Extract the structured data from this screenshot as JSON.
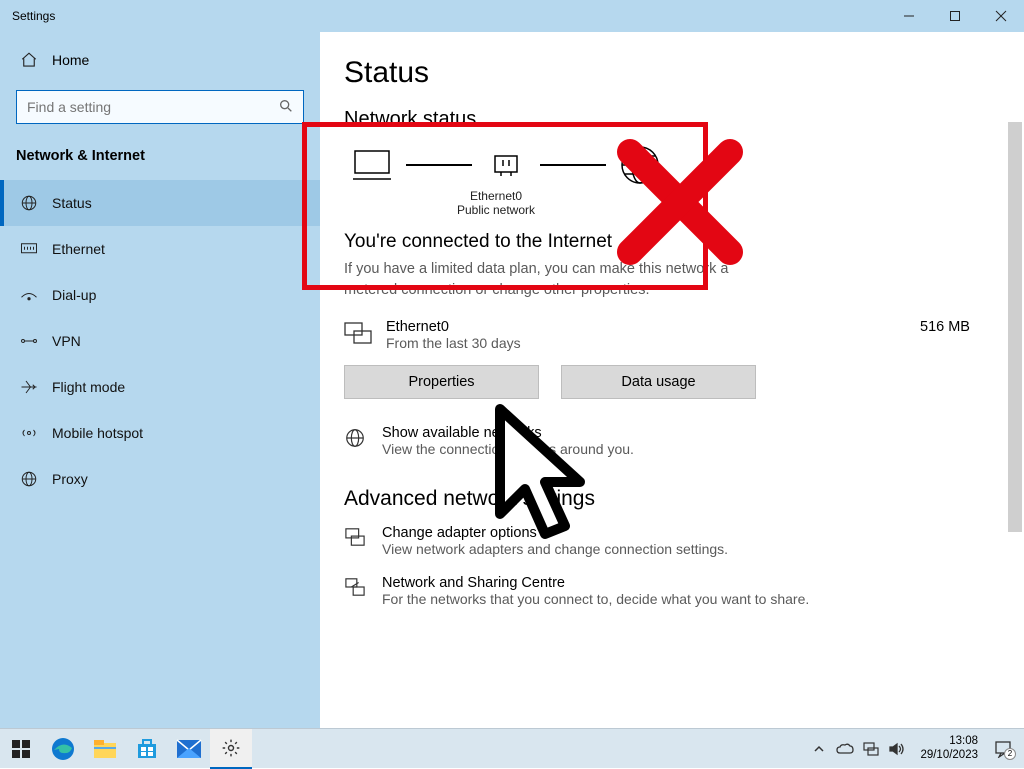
{
  "window_title": "Settings",
  "sidebar": {
    "home": "Home",
    "search_placeholder": "Find a setting",
    "section": "Network & Internet",
    "items": [
      {
        "label": "Status"
      },
      {
        "label": "Ethernet"
      },
      {
        "label": "Dial-up"
      },
      {
        "label": "VPN"
      },
      {
        "label": "Flight mode"
      },
      {
        "label": "Mobile hotspot"
      },
      {
        "label": "Proxy"
      }
    ]
  },
  "main": {
    "title": "Status",
    "network_status_h": "Network status",
    "diagram": {
      "adapter": "Ethernet0",
      "network_type": "Public network"
    },
    "connected_h": "You're connected to the Internet",
    "connected_sub": "If you have a limited data plan, you can make this network a metered connection or change other properties.",
    "connection": {
      "name": "Ethernet0",
      "sub": "From the last 30 days",
      "usage": "516 MB"
    },
    "btn_properties": "Properties",
    "btn_datausage": "Data usage",
    "available": {
      "title": "Show available networks",
      "sub": "View the connection options around you."
    },
    "advanced_h": "Advanced network settings",
    "adapter_opts": {
      "title": "Change adapter options",
      "sub": "View network adapters and change connection settings."
    },
    "sharing": {
      "title": "Network and Sharing Centre",
      "sub": "For the networks that you connect to, decide what you want to share."
    }
  },
  "taskbar": {
    "time": "13:08",
    "date": "29/10/2023"
  }
}
